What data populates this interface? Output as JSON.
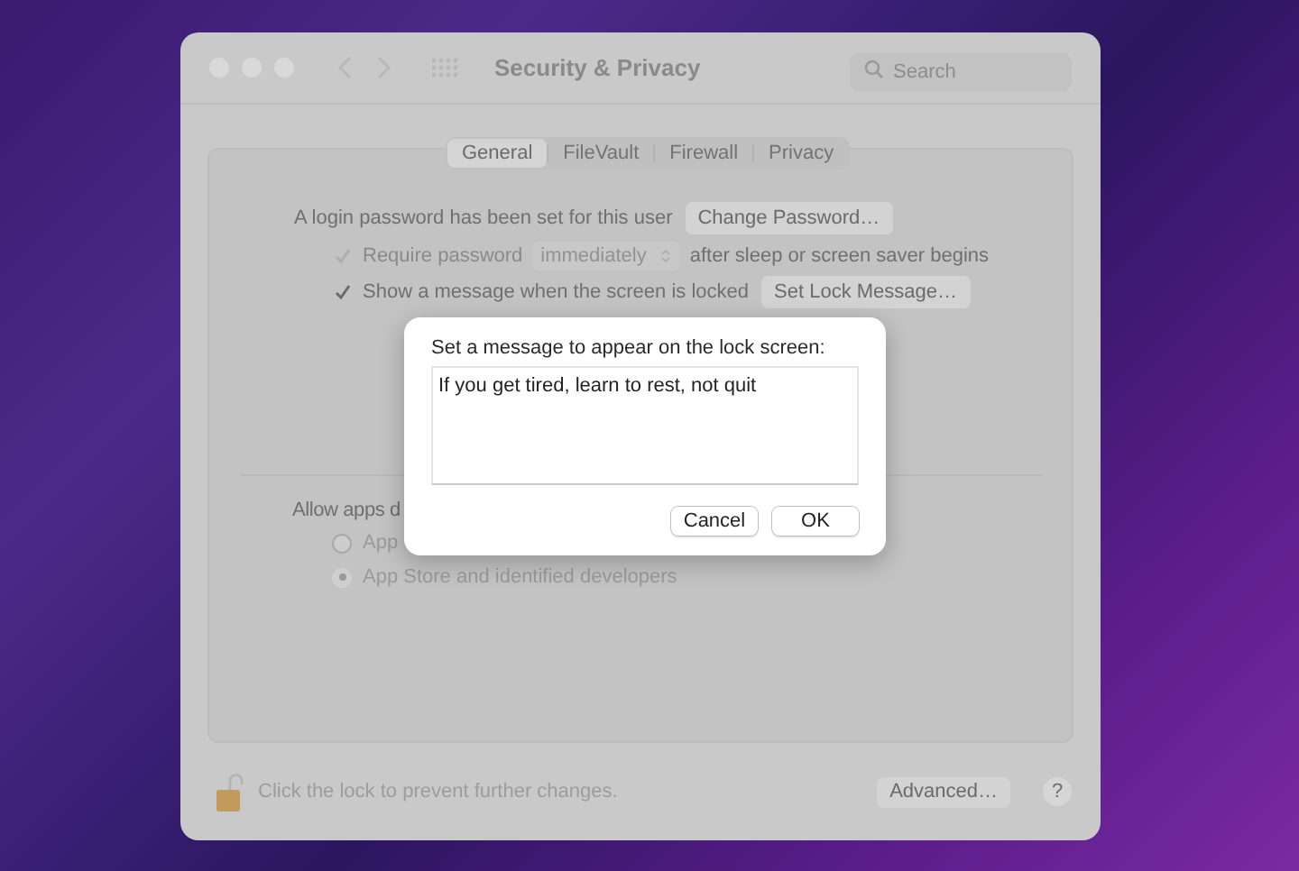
{
  "window": {
    "title": "Security & Privacy",
    "search": {
      "placeholder": "Search"
    }
  },
  "tabs": [
    {
      "label": "General",
      "selected": true
    },
    {
      "label": "FileVault",
      "selected": false
    },
    {
      "label": "Firewall",
      "selected": false
    },
    {
      "label": "Privacy",
      "selected": false
    }
  ],
  "password_row": {
    "label": "A login password has been set for this user",
    "button": "Change Password…"
  },
  "require_password": {
    "label": "Require password",
    "checked": true,
    "disabled": true,
    "popup": "immediately",
    "suffix": "after sleep or screen saver begins"
  },
  "show_message": {
    "label": "Show a message when the screen is locked",
    "checked": true,
    "disabled": false,
    "button": "Set Lock Message…"
  },
  "allow_apps": {
    "label": "Allow apps d",
    "options": [
      {
        "label": "App",
        "selected": false
      },
      {
        "label": "App Store and identified developers",
        "selected": true
      }
    ]
  },
  "footer": {
    "locked": false,
    "text": "Click the lock to prevent further changes.",
    "button": "Advanced…",
    "help": "?"
  },
  "sheet": {
    "prompt": "Set a message to appear on the lock screen:",
    "message": "If you get tired, learn to rest, not quit",
    "buttons": [
      {
        "label": "Cancel",
        "default": false
      },
      {
        "label": "OK",
        "default": false
      }
    ]
  }
}
